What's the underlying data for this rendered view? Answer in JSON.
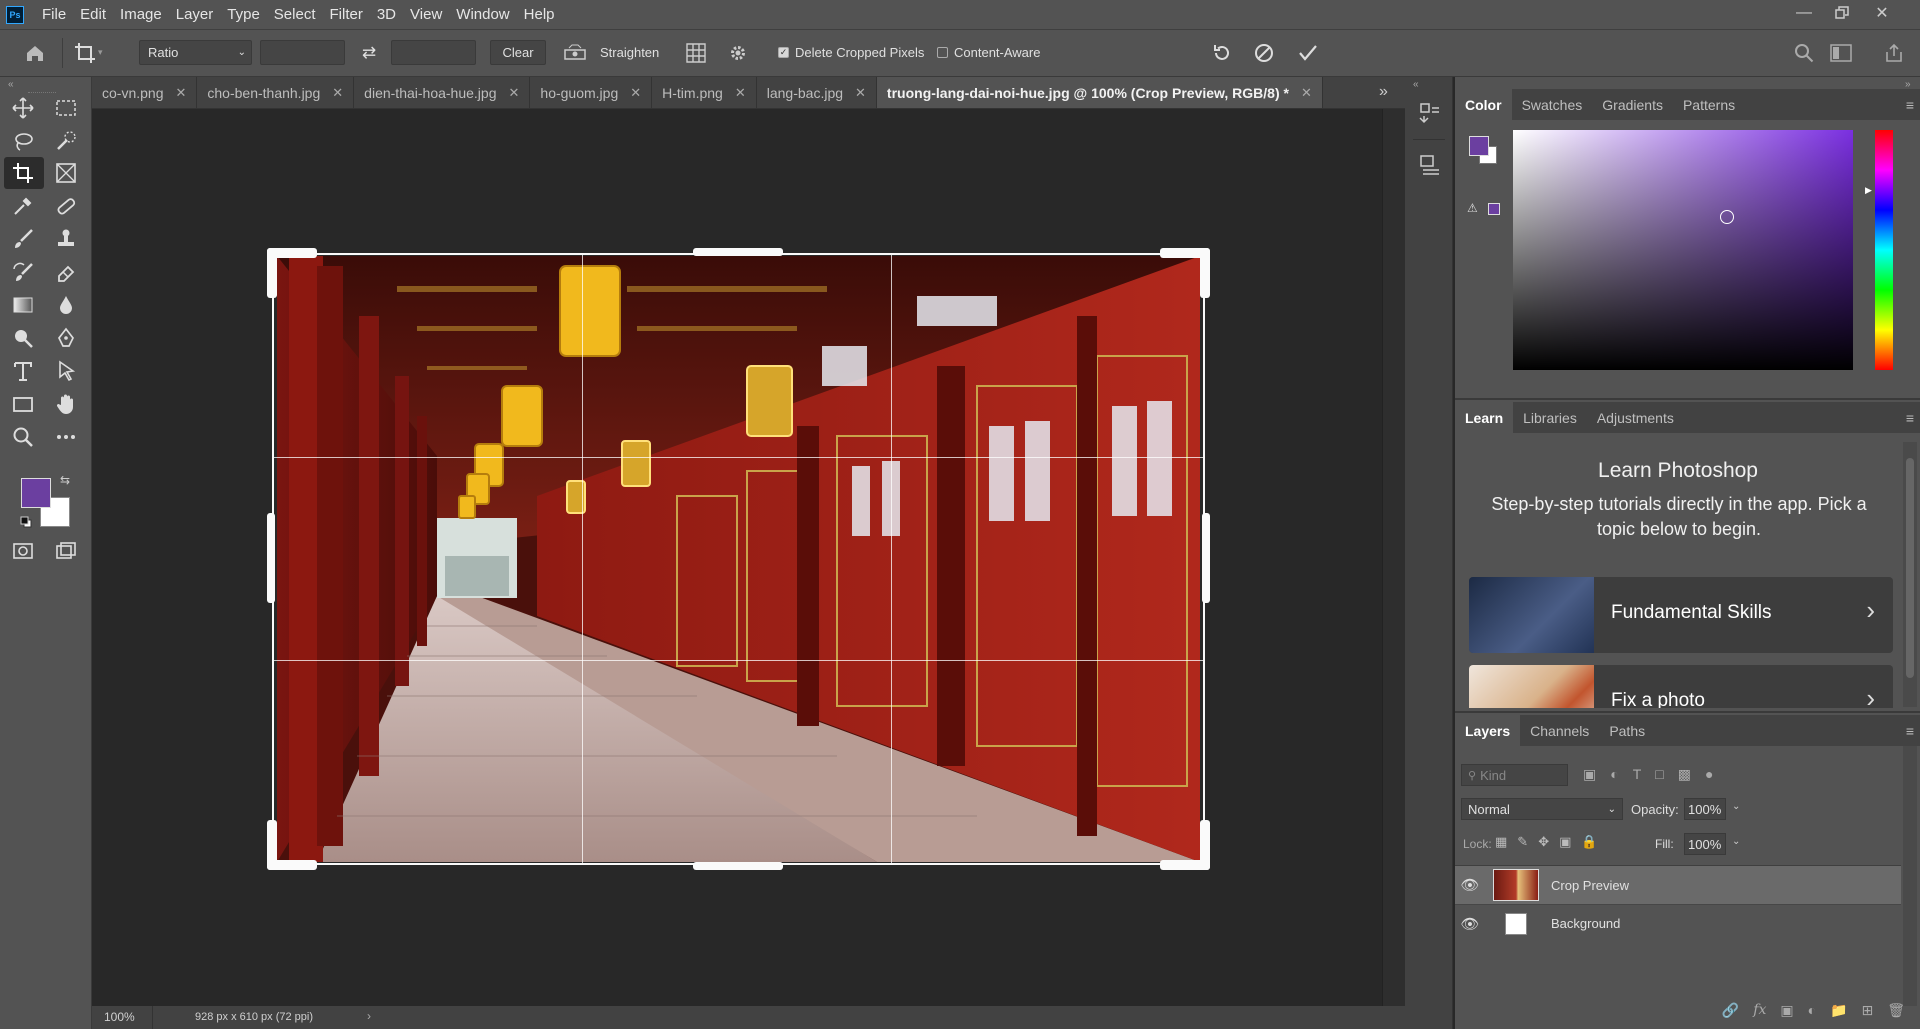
{
  "app": {
    "logo": "Ps"
  },
  "menu": [
    "File",
    "Edit",
    "Image",
    "Layer",
    "Type",
    "Select",
    "Filter",
    "3D",
    "View",
    "Window",
    "Help"
  ],
  "options": {
    "ratio_label": "Ratio",
    "width_value": "",
    "height_value": "",
    "clear_label": "Clear",
    "straighten_label": "Straighten",
    "delete_cropped_label": "Delete Cropped Pixels",
    "delete_cropped_checked": true,
    "content_aware_label": "Content-Aware",
    "content_aware_checked": false
  },
  "tabs": [
    {
      "label": "co-vn.png",
      "active": false
    },
    {
      "label": "cho-ben-thanh.jpg",
      "active": false
    },
    {
      "label": "dien-thai-hoa-hue.jpg",
      "active": false
    },
    {
      "label": "ho-guom.jpg",
      "active": false
    },
    {
      "label": "H-tim.png",
      "active": false
    },
    {
      "label": "lang-bac.jpg",
      "active": false
    },
    {
      "label": "truong-lang-dai-noi-hue.jpg @ 100% (Crop Preview, RGB/8) *",
      "active": true
    }
  ],
  "colors": {
    "foreground": "#6b3fa0",
    "background": "#ffffff",
    "accent": "#31a8ff"
  },
  "status": {
    "zoom": "100%",
    "doc_info": "928 px x 610 px (72 ppi)"
  },
  "color_panel": {
    "tabs": [
      "Color",
      "Swatches",
      "Gradients",
      "Patterns"
    ]
  },
  "learn_panel": {
    "tabs": [
      "Learn",
      "Libraries",
      "Adjustments"
    ],
    "title": "Learn Photoshop",
    "subtitle": "Step-by-step tutorials directly in the app. Pick a topic below to begin.",
    "cards": [
      {
        "label": "Fundamental Skills"
      },
      {
        "label": "Fix a photo"
      }
    ]
  },
  "layers_panel": {
    "tabs": [
      "Layers",
      "Channels",
      "Paths"
    ],
    "kind_placeholder": "Kind",
    "blend_mode": "Normal",
    "opacity_label": "Opacity:",
    "opacity_value": "100%",
    "lock_label": "Lock:",
    "fill_label": "Fill:",
    "fill_value": "100%",
    "layers": [
      {
        "name": "Crop Preview",
        "selected": true
      },
      {
        "name": "Background",
        "selected": false
      }
    ]
  }
}
